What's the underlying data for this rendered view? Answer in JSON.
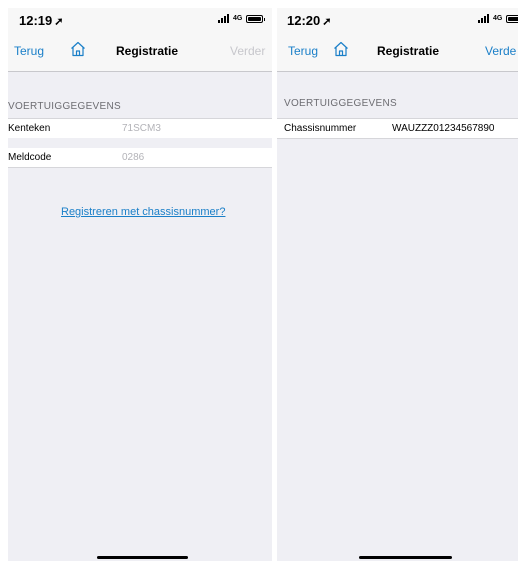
{
  "screens": [
    {
      "status_bar": {
        "time": "12:19",
        "location_glyph": "➚",
        "network": "4G"
      },
      "nav": {
        "back_label": "Terug",
        "title": "Registratie",
        "next_label": "Verder",
        "next_color": "#c7c7cc"
      },
      "section_header": "VOERTUIGGEGEVENS",
      "rows": [
        {
          "label": "Kenteken",
          "value": "71SCM3"
        },
        {
          "label": "Meldcode",
          "value": "0286"
        }
      ],
      "link_label": "Registreren met chassisnummer?"
    },
    {
      "status_bar": {
        "time": "12:20",
        "location_glyph": "➚",
        "network": "4G"
      },
      "nav": {
        "back_label": "Terug",
        "title": "Registratie",
        "next_label": "Verde",
        "next_color": "#1a7fc8"
      },
      "section_header": "VOERTUIGGEGEVENS",
      "rows": [
        {
          "label": "Chassisnummer",
          "value": "WAUZZZ01234567890"
        }
      ]
    }
  ],
  "colors": {
    "accent": "#1a7fc8",
    "grouped_background": "#efeff4",
    "nav_background": "#f7f7f7",
    "secondary_text": "#6d6d72"
  },
  "icons": {
    "home": "home-icon",
    "signal": "signal-icon",
    "battery": "battery-icon",
    "location": "location-arrow-icon"
  }
}
